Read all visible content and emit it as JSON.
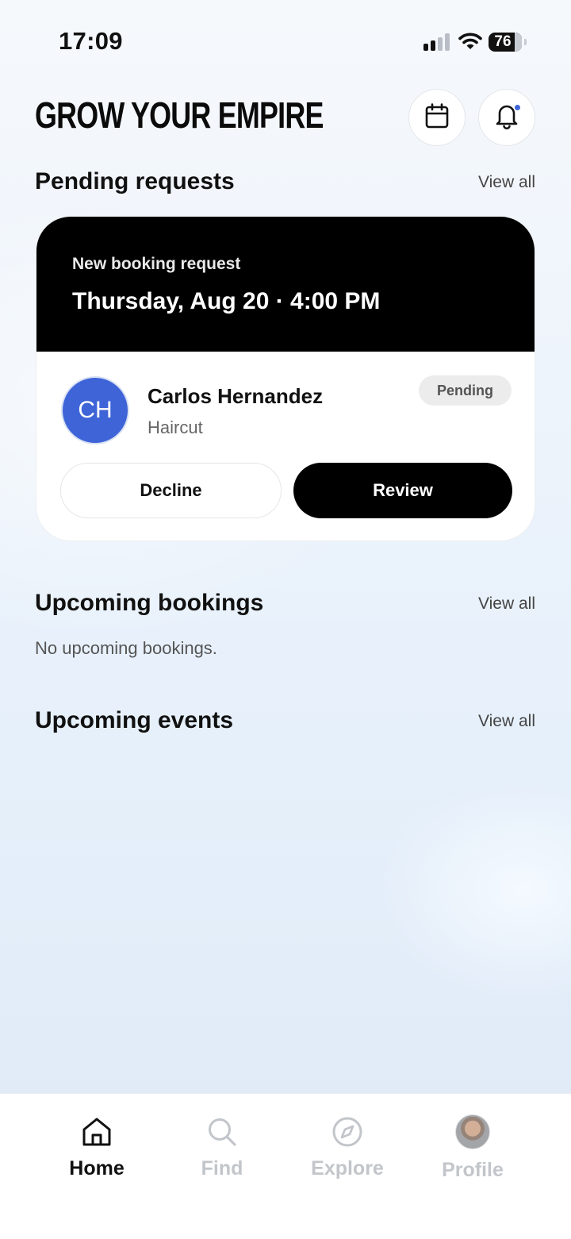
{
  "status_bar": {
    "time": "17:09",
    "battery": "76"
  },
  "header": {
    "title": "GROW YOUR EMPIRE",
    "calendar_icon": "calendar-icon",
    "notification_icon": "bell-icon"
  },
  "pending": {
    "title": "Pending requests",
    "view_all": "View all",
    "card": {
      "kicker": "New booking request",
      "when": "Thursday, Aug 20 · 4:00 PM",
      "initials": "CH",
      "client": "Carlos Hernandez",
      "service": "Haircut",
      "status": "Pending",
      "decline_label": "Decline",
      "review_label": "Review"
    }
  },
  "bookings": {
    "title": "Upcoming bookings",
    "view_all": "View all",
    "empty": "No upcoming bookings."
  },
  "events": {
    "title": "Upcoming events",
    "view_all": "View all"
  },
  "nav": {
    "items": [
      {
        "label": "Home",
        "icon": "home-icon",
        "active": true
      },
      {
        "label": "Find",
        "icon": "search-icon",
        "active": false
      },
      {
        "label": "Explore",
        "icon": "compass-icon",
        "active": false
      },
      {
        "label": "Profile",
        "icon": "profile-avatar",
        "active": false
      }
    ]
  },
  "colors": {
    "accent": "#3e64d8",
    "primary_button": "#000000",
    "badge_bg": "#ececec"
  }
}
